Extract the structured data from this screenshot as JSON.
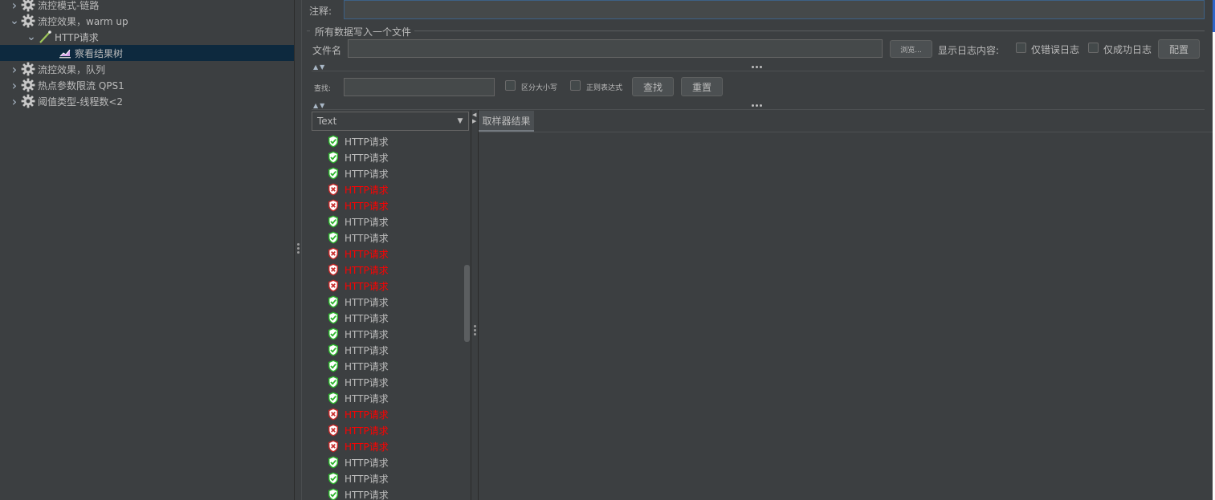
{
  "tree": {
    "nodes": [
      {
        "label": "流控模式-链路",
        "type": "gear",
        "expanded": false
      },
      {
        "label": "流控效果，warm up",
        "type": "gear",
        "expanded": true
      },
      {
        "label": "HTTP请求",
        "type": "sampler",
        "expanded": true
      },
      {
        "label": "察看结果树",
        "type": "listener",
        "selected": true
      },
      {
        "label": "流控效果，队列",
        "type": "gear",
        "expanded": false
      },
      {
        "label": "热点参数限流 QPS1",
        "type": "gear",
        "expanded": false
      },
      {
        "label": "阈值类型-线程数<2",
        "type": "gear",
        "expanded": false
      }
    ]
  },
  "comment": {
    "label": "注释:",
    "value": ""
  },
  "file_section": {
    "title": "所有数据写入一个文件",
    "filename_label": "文件名",
    "filename_value": "",
    "browse_button": "浏览...",
    "log_content_label": "显示日志内容:",
    "errors_only_label": "仅错误日志",
    "success_only_label": "仅成功日志",
    "configure_button": "配置"
  },
  "search": {
    "label": "查找:",
    "value": "",
    "case_sensitive_label": "区分大小写",
    "regex_label": "正则表达式",
    "find_button": "查找",
    "reset_button": "重置"
  },
  "renderer": {
    "selected": "Text"
  },
  "results": [
    {
      "label": "HTTP请求",
      "status": "ok"
    },
    {
      "label": "HTTP请求",
      "status": "ok"
    },
    {
      "label": "HTTP请求",
      "status": "ok"
    },
    {
      "label": "HTTP请求",
      "status": "fail"
    },
    {
      "label": "HTTP请求",
      "status": "fail"
    },
    {
      "label": "HTTP请求",
      "status": "ok"
    },
    {
      "label": "HTTP请求",
      "status": "ok"
    },
    {
      "label": "HTTP请求",
      "status": "fail"
    },
    {
      "label": "HTTP请求",
      "status": "fail"
    },
    {
      "label": "HTTP请求",
      "status": "fail"
    },
    {
      "label": "HTTP请求",
      "status": "ok"
    },
    {
      "label": "HTTP请求",
      "status": "ok"
    },
    {
      "label": "HTTP请求",
      "status": "ok"
    },
    {
      "label": "HTTP请求",
      "status": "ok"
    },
    {
      "label": "HTTP请求",
      "status": "ok"
    },
    {
      "label": "HTTP请求",
      "status": "ok"
    },
    {
      "label": "HTTP请求",
      "status": "ok"
    },
    {
      "label": "HTTP请求",
      "status": "fail"
    },
    {
      "label": "HTTP请求",
      "status": "fail"
    },
    {
      "label": "HTTP请求",
      "status": "fail"
    },
    {
      "label": "HTTP请求",
      "status": "ok"
    },
    {
      "label": "HTTP请求",
      "status": "ok"
    },
    {
      "label": "HTTP请求",
      "status": "ok"
    }
  ],
  "sampler_result_tab": "取样器结果",
  "colors": {
    "background": "#3c3f41",
    "selected_row": "#0d293e",
    "success_icon": "#2bb52b",
    "fail_icon": "#c62828",
    "fail_text": "#ff0000"
  }
}
